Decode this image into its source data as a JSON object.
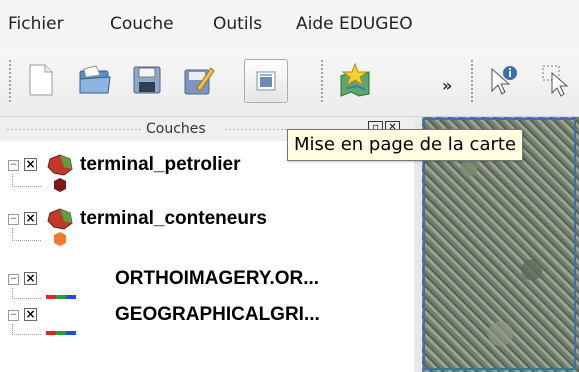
{
  "menu": [
    "Fichier",
    "Couche",
    "Outils",
    "Aide EDUGEO"
  ],
  "toolbar": {
    "icons": [
      "new-document-icon",
      "open-folder-icon",
      "save-floppy-icon",
      "edit-pencil-icon",
      "print-composer-icon",
      "star-map-icon"
    ],
    "more_label": "»"
  },
  "layers_panel": {
    "title": "Couches",
    "layers": [
      {
        "name": "terminal_petrolier",
        "legend_color": "#7a1a1a",
        "checked": true
      },
      {
        "name": "terminal_conteneurs",
        "legend_color": "#f07a2a",
        "checked": true
      },
      {
        "name": "ORTHOIMAGERY.OR...",
        "checked": true
      },
      {
        "name": "GEOGRAPHICALGRI...",
        "checked": true
      }
    ]
  },
  "tooltip": {
    "text": "Mise en page de la carte"
  },
  "colors": {
    "map_border": "#3a6fb0",
    "tooltip_bg": "#ffffe1"
  }
}
